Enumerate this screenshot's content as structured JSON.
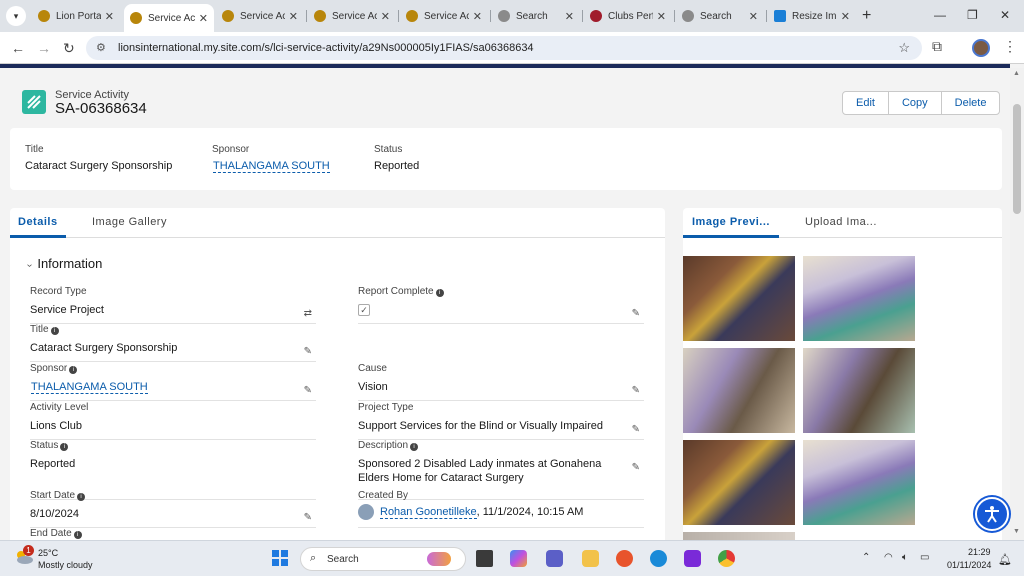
{
  "browser": {
    "tabs": [
      {
        "label": "Lion Porta",
        "color": "#b8860b"
      },
      {
        "label": "Service Ac",
        "color": "#b8860b",
        "active": true
      },
      {
        "label": "Service Ac",
        "color": "#b8860b"
      },
      {
        "label": "Service Ac",
        "color": "#b8860b"
      },
      {
        "label": "Service Ac",
        "color": "#b8860b"
      },
      {
        "label": "Search",
        "color": "#8a8a8a"
      },
      {
        "label": "Clubs Perf",
        "color": "#a01c2c"
      },
      {
        "label": "Search",
        "color": "#8a8a8a"
      },
      {
        "label": "Resize Im",
        "color": "#1a7fd6"
      }
    ],
    "url": "lionsinternational.my.site.com/s/lci-service-activity/a29Ns000005Iy1FIAS/sa06368634"
  },
  "record": {
    "object_label": "Service Activity",
    "name": "SA-06368634",
    "actions": [
      "Edit",
      "Copy",
      "Delete"
    ]
  },
  "highlights": {
    "title_label": "Title",
    "title_value": "Cataract Surgery Sponsorship",
    "sponsor_label": "Sponsor",
    "sponsor_value": "THALANGAMA SOUTH",
    "status_label": "Status",
    "status_value": "Reported"
  },
  "details": {
    "tabs": [
      "Details",
      "Image Gallery"
    ],
    "section": "Information",
    "record_type_label": "Record Type",
    "record_type_value": "Service Project",
    "report_complete_label": "Report Complete",
    "report_complete_check": "✓",
    "title_label": "Title",
    "title_value": "Cataract Surgery Sponsorship",
    "sponsor_label": "Sponsor",
    "sponsor_value": "THALANGAMA SOUTH",
    "cause_label": "Cause",
    "cause_value": "Vision",
    "activity_level_label": "Activity Level",
    "activity_level_value": "Lions Club",
    "project_type_label": "Project Type",
    "project_type_value": "Support Services for the Blind or Visually Impaired",
    "status_label": "Status",
    "status_value": "Reported",
    "description_label": "Description",
    "description_value": "Sponsored 2 Disabled Lady inmates at Gonahena Elders Home for Cataract Surgery",
    "start_date_label": "Start Date",
    "start_date_value": "8/10/2024",
    "created_by_label": "Created By",
    "created_by_name": "Rohan Goonetilleke",
    "created_by_date": ", 11/1/2024, 10:15 AM",
    "end_date_label": "End Date"
  },
  "images": {
    "tabs": [
      "Image Previ...",
      "Upload Ima..."
    ]
  },
  "taskbar": {
    "weather_badge": "1",
    "temperature": "25°C",
    "weather": "Mostly cloudy",
    "search_placeholder": "Search",
    "time": "21:29",
    "date": "01/11/2024"
  }
}
